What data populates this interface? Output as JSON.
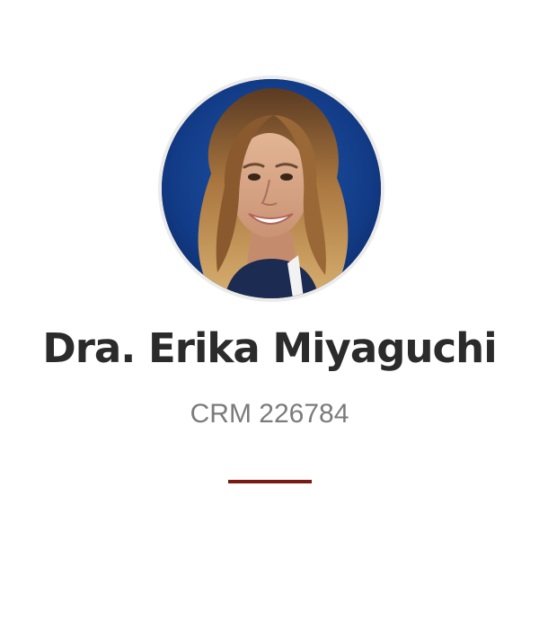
{
  "profile": {
    "name": "Dra. Erika Miyaguchi",
    "registration": "CRM 226784",
    "accent_color": "#7a1a14",
    "photo_background": "#123b86",
    "avatar_icon": "portrait-photo"
  }
}
